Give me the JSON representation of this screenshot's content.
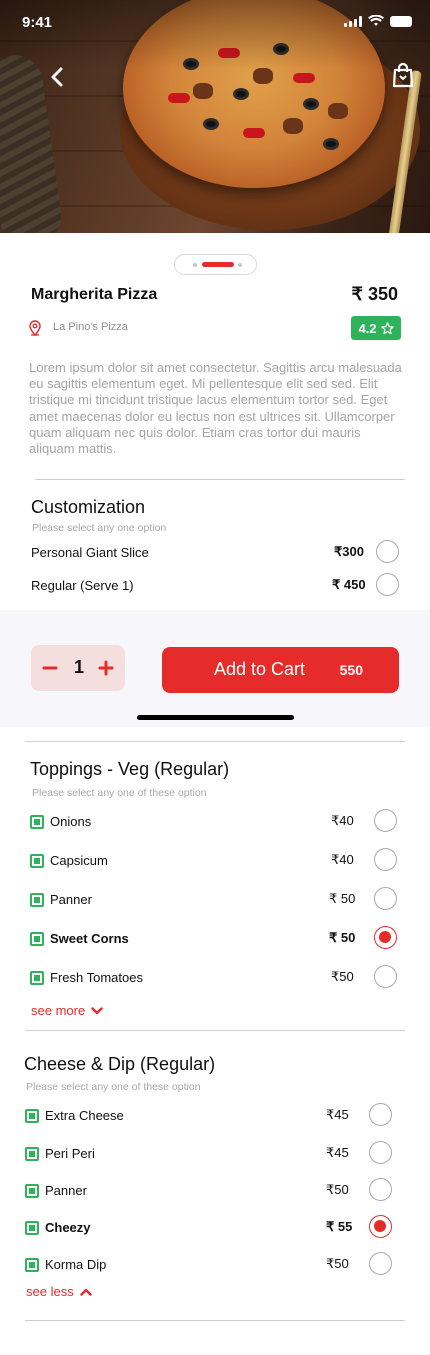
{
  "status_bar": {
    "time": "9:41"
  },
  "product": {
    "name": "Margherita Pizza",
    "price": "₹ 350",
    "restaurant": "La Pino's Pizza",
    "rating": "4.2",
    "description": "Lorem ipsum dolor sit amet consectetur. Sagittis arcu malesuada eu sagittis elementum eget. Mi pellentesque elit sed sed. Elit tristique mi tincidunt tristique lacus elementum tortor sed. Eget amet maecenas dolor eu lectus non est ultrices sit. Ullamcorper quam aliquam nec quis dolor. Etiam cras tortor dui mauris aliquam mattis."
  },
  "customization": {
    "title": "Customization",
    "subtitle": "Please select any one option",
    "options": [
      {
        "name": "Personal Giant Slice",
        "price": "₹300",
        "selected": false
      },
      {
        "name": "Regular (Serve 1)",
        "price": "₹ 450",
        "selected": false
      }
    ]
  },
  "cart": {
    "quantity": "1",
    "add_label": "Add to Cart",
    "total": "550"
  },
  "toppings": {
    "title": "Toppings - Veg (Regular)",
    "subtitle": "Please select any one of these option",
    "options": [
      {
        "name": "Onions",
        "price": "₹40",
        "selected": false
      },
      {
        "name": "Capsicum",
        "price": "₹40",
        "selected": false
      },
      {
        "name": "Panner",
        "price": "₹ 50",
        "selected": false
      },
      {
        "name": "Sweet Corns",
        "price": "₹ 50",
        "selected": true
      },
      {
        "name": "Fresh Tomatoes",
        "price": "₹50",
        "selected": false
      }
    ],
    "link": "see more"
  },
  "cheese": {
    "title": "Cheese & Dip (Regular)",
    "subtitle": "Please select any one of these option",
    "options": [
      {
        "name": "Extra Cheese",
        "price": "₹45",
        "selected": false
      },
      {
        "name": "Peri Peri",
        "price": "₹45",
        "selected": false
      },
      {
        "name": "Panner",
        "price": "₹50",
        "selected": false
      },
      {
        "name": "Cheezy",
        "price": "₹ 55",
        "selected": true
      },
      {
        "name": "Korma Dip",
        "price": "₹50",
        "selected": false
      }
    ],
    "link": "see less"
  },
  "icons": {
    "back": "chevron-left-icon",
    "bag": "shopping-bag-icon",
    "location": "map-pin-icon",
    "rating_star": "star-icon",
    "veg_marker": "veg-indicator-icon",
    "expand": "chevron-down-icon",
    "collapse": "chevron-up-icon"
  },
  "colors": {
    "accent": "#e62b2b",
    "veg": "#2fb35a",
    "rating_bg": "#2fb35a"
  }
}
